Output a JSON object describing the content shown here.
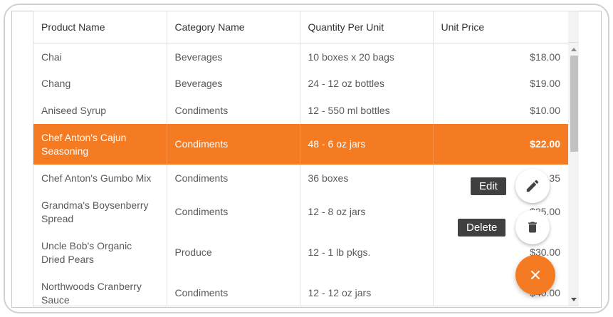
{
  "accent_color": "#f57b22",
  "columns": [
    "Product Name",
    "Category Name",
    "Quantity Per Unit",
    "Unit Price"
  ],
  "rows": [
    {
      "product": "Chai",
      "category": "Beverages",
      "quantity": "10 boxes x 20 bags",
      "price": "$18.00"
    },
    {
      "product": "Chang",
      "category": "Beverages",
      "quantity": "24 - 12 oz bottles",
      "price": "$19.00"
    },
    {
      "product": "Aniseed Syrup",
      "category": "Condiments",
      "quantity": "12 - 550 ml bottles",
      "price": "$10.00"
    },
    {
      "product": "Chef Anton's Cajun Seasoning",
      "category": "Condiments",
      "quantity": "48 - 6 oz jars",
      "price": "$22.00",
      "selected": true
    },
    {
      "product": "Chef Anton's Gumbo Mix",
      "category": "Condiments",
      "quantity": "36 boxes",
      "price": "35"
    },
    {
      "product": "Grandma's Boysenberry Spread",
      "category": "Condiments",
      "quantity": "12 - 8 oz jars",
      "price": "$25.00"
    },
    {
      "product": "Uncle Bob's Organic Dried Pears",
      "category": "Produce",
      "quantity": "12 - 1 lb pkgs.",
      "price": "$30.00"
    },
    {
      "product": "Northwoods Cranberry Sauce",
      "category": "Condiments",
      "quantity": "12 - 12 oz jars",
      "price": "$40.00"
    }
  ],
  "speed_dial": {
    "edit_label": "Edit",
    "delete_label": "Delete",
    "edit_icon": "pencil-icon",
    "delete_icon": "trash-icon",
    "main_icon": "close-icon"
  }
}
